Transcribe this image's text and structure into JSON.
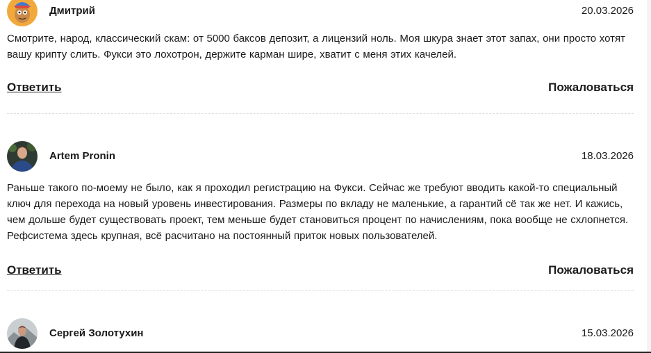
{
  "comments": [
    {
      "author": "Дмитрий",
      "date": "20.03.2026",
      "avatar_icon": "cartoon-avatar-icon",
      "text": "Смотрите, народ, классический скам: от 5000 баксов депозит, а лицензий ноль. Моя шкура знает этот запах, они просто хотят вашу крипту слить. Фукси это лохотрон, держите карман шире, хватит с меня этих качелей.",
      "reply_label": "Ответить",
      "report_label": "Пожаловаться"
    },
    {
      "author": "Artem Pronin",
      "date": "18.03.2026",
      "avatar_icon": "user-photo-icon",
      "text": "Раньше такого по-моему не было, как я проходил регистрацию на Фукси. Сейчас же требуют вводить какой-то специальный ключ для перехода на новый уровень инвестирования. Размеры по вкладу не маленькие, а гарантий сё так же нет. И кажись, чем дольше будет существовать проект, тем меньше будет становиться процент по начислениям, пока вообще не схлопнется. Рефсистема здесь крупная, всё расчитано на постоянный приток новых пользователей.",
      "reply_label": "Ответить",
      "report_label": "Пожаловаться"
    },
    {
      "author": "Сергей Золотухин",
      "date": "15.03.2026",
      "avatar_icon": "user-photo-icon"
    }
  ]
}
